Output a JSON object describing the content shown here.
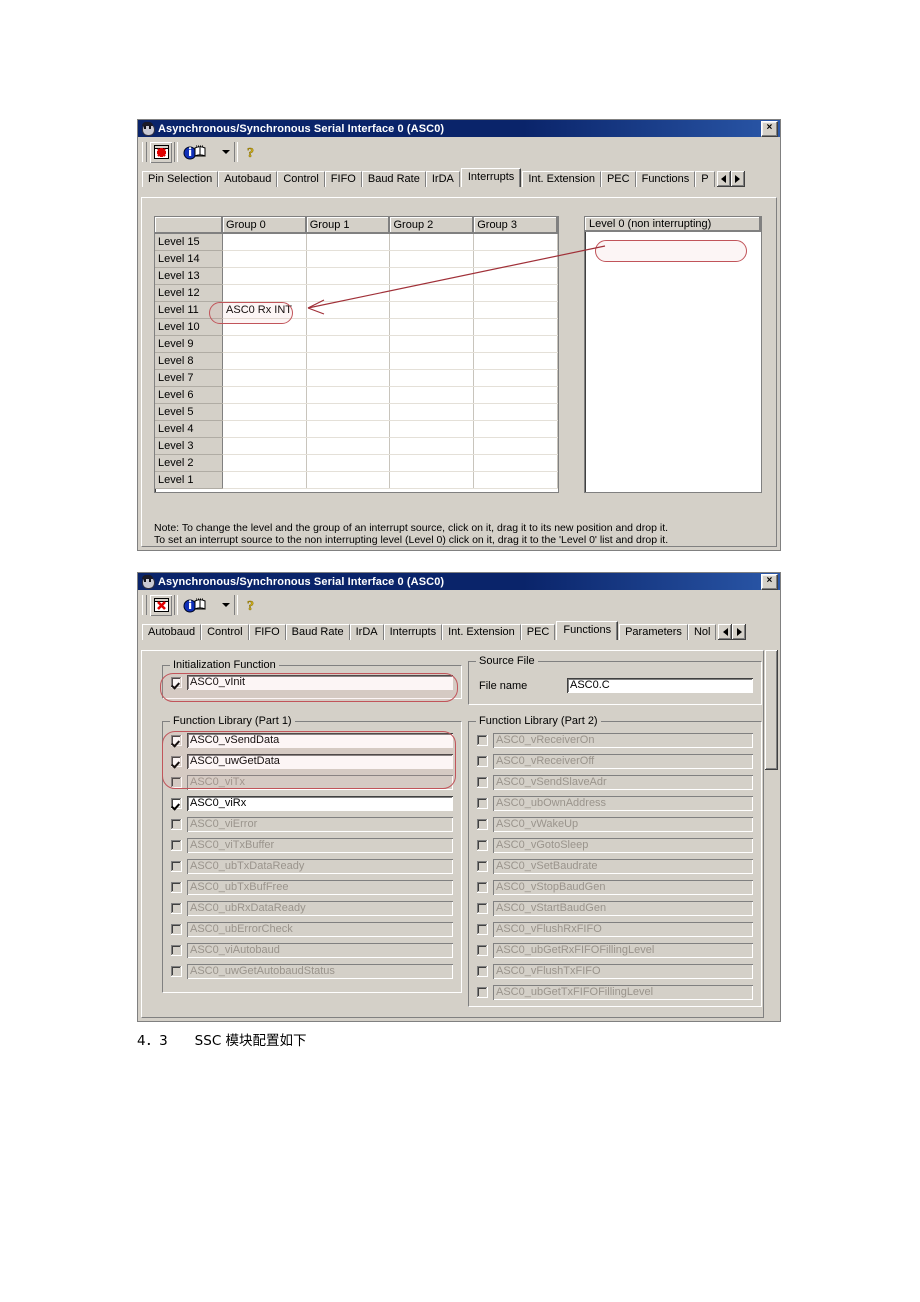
{
  "window1": {
    "title": "Asynchronous/Synchronous Serial Interface 0 (ASC0)",
    "close_label": "×",
    "icon": "app-face-icon",
    "toolbar": {
      "buttons": [
        {
          "name": "close-red-x-icon",
          "label": ""
        },
        {
          "name": "info-book-icon",
          "label": ""
        },
        {
          "name": "dropdown-arrow-icon",
          "label": "▾"
        },
        {
          "name": "help-question-icon",
          "label": "?"
        }
      ]
    },
    "tabs": [
      {
        "label": "Pin Selection",
        "selected": false
      },
      {
        "label": "Autobaud",
        "selected": false
      },
      {
        "label": "Control",
        "selected": false
      },
      {
        "label": "FIFO",
        "selected": false
      },
      {
        "label": "Baud Rate",
        "selected": false
      },
      {
        "label": "IrDA",
        "selected": false
      },
      {
        "label": "Interrupts",
        "selected": true
      },
      {
        "label": "Int. Extension",
        "selected": false
      },
      {
        "label": "PEC",
        "selected": false
      },
      {
        "label": "Functions",
        "selected": false
      },
      {
        "label": "P",
        "selected": false
      }
    ],
    "interrupt_table": {
      "columns": [
        "",
        "Group 0",
        "Group 1",
        "Group 2",
        "Group 3"
      ],
      "rows": [
        {
          "level": "Level 15",
          "cells": [
            "",
            "",
            "",
            ""
          ]
        },
        {
          "level": "Level 14",
          "cells": [
            "",
            "",
            "",
            ""
          ]
        },
        {
          "level": "Level 13",
          "cells": [
            "",
            "",
            "",
            ""
          ]
        },
        {
          "level": "Level 12",
          "cells": [
            "",
            "",
            "",
            ""
          ]
        },
        {
          "level": "Level 11",
          "cells": [
            "ASC0 Rx INT",
            "",
            "",
            ""
          ]
        },
        {
          "level": "Level 10",
          "cells": [
            "",
            "",
            "",
            ""
          ]
        },
        {
          "level": "Level 9",
          "cells": [
            "",
            "",
            "",
            ""
          ]
        },
        {
          "level": "Level 8",
          "cells": [
            "",
            "",
            "",
            ""
          ]
        },
        {
          "level": "Level 7",
          "cells": [
            "",
            "",
            "",
            ""
          ]
        },
        {
          "level": "Level 6",
          "cells": [
            "",
            "",
            "",
            ""
          ]
        },
        {
          "level": "Level 5",
          "cells": [
            "",
            "",
            "",
            ""
          ]
        },
        {
          "level": "Level 4",
          "cells": [
            "",
            "",
            "",
            ""
          ]
        },
        {
          "level": "Level 3",
          "cells": [
            "",
            "",
            "",
            ""
          ]
        },
        {
          "level": "Level 2",
          "cells": [
            "",
            "",
            "",
            ""
          ]
        },
        {
          "level": "Level 1",
          "cells": [
            "",
            "",
            "",
            ""
          ]
        }
      ]
    },
    "level0_panel": {
      "header": "Level 0 (non interrupting)",
      "items": []
    },
    "note_line1": "Note: To change the level and the group of an interrupt source, click on it, drag it to its new position and drop it.",
    "note_line2": "To set an interrupt source to the non interrupting level (Level 0) click on it, drag it to the 'Level 0' list and drop it."
  },
  "window2": {
    "title": "Asynchronous/Synchronous Serial Interface 0 (ASC0)",
    "close_label": "×",
    "tabs": [
      {
        "label": "Autobaud",
        "selected": false
      },
      {
        "label": "Control",
        "selected": false
      },
      {
        "label": "FIFO",
        "selected": false
      },
      {
        "label": "Baud Rate",
        "selected": false
      },
      {
        "label": "IrDA",
        "selected": false
      },
      {
        "label": "Interrupts",
        "selected": false
      },
      {
        "label": "Int. Extension",
        "selected": false
      },
      {
        "label": "PEC",
        "selected": false
      },
      {
        "label": "Functions",
        "selected": true
      },
      {
        "label": "Parameters",
        "selected": false
      },
      {
        "label": "Nol",
        "selected": false
      }
    ],
    "init_function": {
      "legend": "Initialization Function",
      "items": [
        {
          "label": "ASC0_vInit",
          "checked": true,
          "enabled": true
        }
      ]
    },
    "source_file": {
      "legend": "Source File",
      "field_label": "File name",
      "value": "ASC0.C"
    },
    "library_part1": {
      "legend": "Function Library (Part 1)",
      "items": [
        {
          "label": "ASC0_vSendData",
          "checked": true,
          "enabled": true
        },
        {
          "label": "ASC0_uwGetData",
          "checked": true,
          "enabled": true
        },
        {
          "label": "ASC0_viTx",
          "checked": false,
          "enabled": false
        },
        {
          "label": "ASC0_viRx",
          "checked": true,
          "enabled": true
        },
        {
          "label": "ASC0_viError",
          "checked": false,
          "enabled": false
        },
        {
          "label": "ASC0_viTxBuffer",
          "checked": false,
          "enabled": false
        },
        {
          "label": "ASC0_ubTxDataReady",
          "checked": false,
          "enabled": false
        },
        {
          "label": "ASC0_ubTxBufFree",
          "checked": false,
          "enabled": false
        },
        {
          "label": "ASC0_ubRxDataReady",
          "checked": false,
          "enabled": false
        },
        {
          "label": "ASC0_ubErrorCheck",
          "checked": false,
          "enabled": false
        },
        {
          "label": "ASC0_viAutobaud",
          "checked": false,
          "enabled": false
        },
        {
          "label": "ASC0_uwGetAutobaudStatus",
          "checked": false,
          "enabled": false
        }
      ]
    },
    "library_part2": {
      "legend": "Function Library (Part 2)",
      "items": [
        {
          "label": "ASC0_vReceiverOn",
          "checked": false,
          "enabled": false
        },
        {
          "label": "ASC0_vReceiverOff",
          "checked": false,
          "enabled": false
        },
        {
          "label": "ASC0_vSendSlaveAdr",
          "checked": false,
          "enabled": false
        },
        {
          "label": "ASC0_ubOwnAddress",
          "checked": false,
          "enabled": false
        },
        {
          "label": "ASC0_vWakeUp",
          "checked": false,
          "enabled": false
        },
        {
          "label": "ASC0_vGotoSleep",
          "checked": false,
          "enabled": false
        },
        {
          "label": "ASC0_vSetBaudrate",
          "checked": false,
          "enabled": false
        },
        {
          "label": "ASC0_vStopBaudGen",
          "checked": false,
          "enabled": false
        },
        {
          "label": "ASC0_vStartBaudGen",
          "checked": false,
          "enabled": false
        },
        {
          "label": "ASC0_vFlushRxFIFO",
          "checked": false,
          "enabled": false
        },
        {
          "label": "ASC0_ubGetRxFIFOFillingLevel",
          "checked": false,
          "enabled": false
        },
        {
          "label": "ASC0_vFlushTxFIFO",
          "checked": false,
          "enabled": false
        },
        {
          "label": "ASC0_ubGetTxFIFOFillingLevel",
          "checked": false,
          "enabled": false
        }
      ]
    }
  },
  "document": {
    "caption": "4．3　　SSC 模块配置如下"
  },
  "colors": {
    "title_bar": "#0a246a",
    "face": "#d4d0c8",
    "annotation": "#c1545a",
    "field_bg": "#ffffff",
    "disabled_text": "#9a948c"
  }
}
